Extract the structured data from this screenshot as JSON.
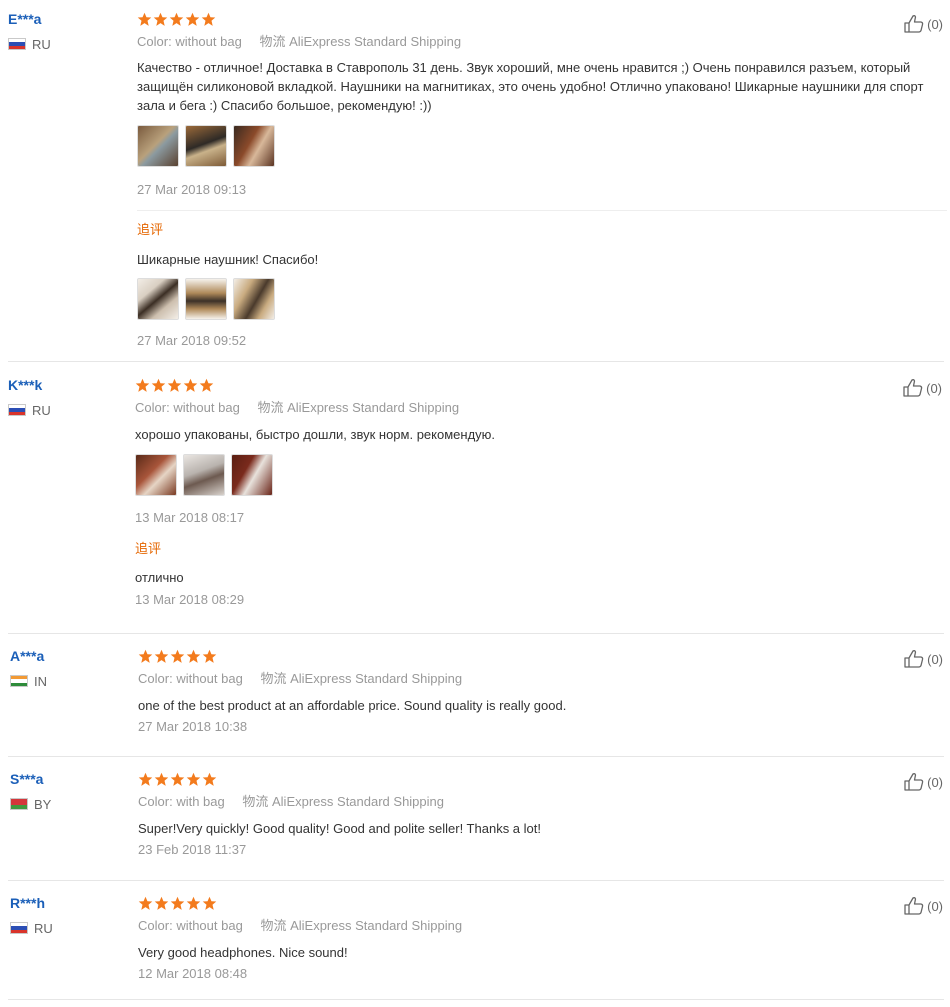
{
  "colors": {
    "star": "#f37b1d",
    "username": "#1b5fb8",
    "followup_label": "#e56600",
    "muted": "#999999"
  },
  "reviews": [
    {
      "user": "E***a",
      "country": "RU",
      "flag": "ru",
      "stars": 5,
      "color_label": "Color:",
      "color_value": "without bag",
      "logistics_label": "物流",
      "logistics_value": "AliExpress Standard Shipping",
      "text": "Качество - отличное! Доставка в Ставрополь 31 день. Звук хороший, мне очень нравится ;) Очень понравился разъем, который защищён силиконовой вкладкой. Наушники на магнитиках, это очень удобно! Отлично упаковано! Шикарные наушники для спорт зала и бега :) Спасибо большое, рекомендую! :))",
      "date": "27 Mar 2018 09:13",
      "helpful": "(0)",
      "followup": {
        "label": "追评",
        "text": "Шикарные наушник! Спасибо!",
        "date": "27 Mar 2018 09:52"
      }
    },
    {
      "user": "K***k",
      "country": "RU",
      "flag": "ru",
      "stars": 5,
      "color_label": "Color:",
      "color_value": "without bag",
      "logistics_label": "物流",
      "logistics_value": "AliExpress Standard Shipping",
      "text": "хорошо упакованы, быстро дошли, звук норм. рекомендую.",
      "date": "13 Mar 2018 08:17",
      "helpful": "(0)",
      "followup": {
        "label": "追评",
        "text": "отлично",
        "date": "13 Mar 2018 08:29"
      }
    },
    {
      "user": "A***a",
      "country": "IN",
      "flag": "in",
      "stars": 5,
      "color_label": "Color:",
      "color_value": "without bag",
      "logistics_label": "物流",
      "logistics_value": "AliExpress Standard Shipping",
      "text": "one of the best product at an affordable price. Sound quality is really good.",
      "date": "27 Mar 2018 10:38",
      "helpful": "(0)"
    },
    {
      "user": "S***a",
      "country": "BY",
      "flag": "by",
      "stars": 5,
      "color_label": "Color:",
      "color_value": "with bag",
      "logistics_label": "物流",
      "logistics_value": "AliExpress Standard Shipping",
      "text": "Super!Very quickly! Good quality! Good and polite seller! Thanks a lot!",
      "date": "23 Feb 2018 11:37",
      "helpful": "(0)"
    },
    {
      "user": "R***h",
      "country": "RU",
      "flag": "ru",
      "stars": 5,
      "color_label": "Color:",
      "color_value": "without bag",
      "logistics_label": "物流",
      "logistics_value": "AliExpress Standard Shipping",
      "text": "Very good headphones. Nice sound!",
      "date": "12 Mar 2018 08:48",
      "helpful": "(0)"
    }
  ]
}
